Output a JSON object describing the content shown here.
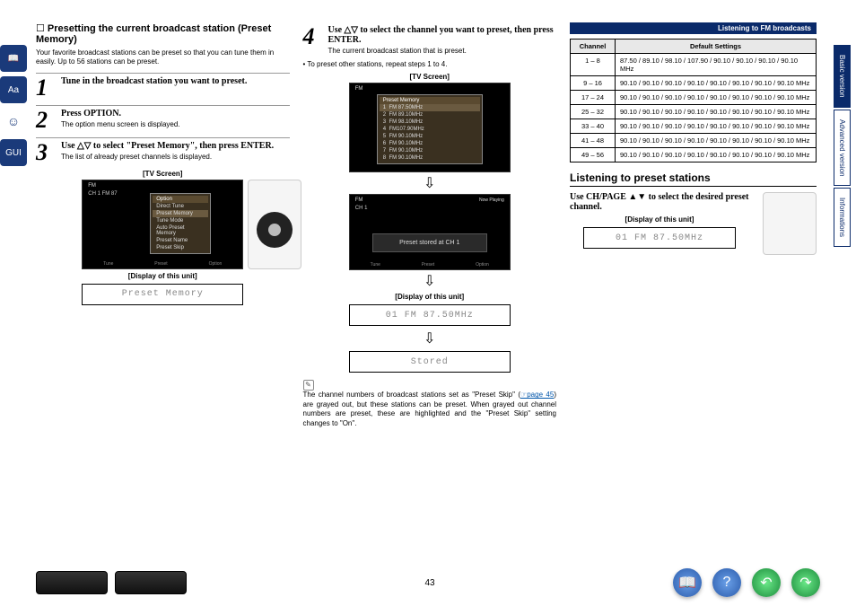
{
  "header": {
    "breadcrumb": "Listening to FM broadcasts"
  },
  "tabs": {
    "basic": "Basic version",
    "advanced": "Advanced version",
    "info": "Informations"
  },
  "left_icons": {
    "book": "book-icon",
    "aa": "Aa",
    "gui": "GUI"
  },
  "section1": {
    "title": "Presetting the current broadcast station (Preset Memory)",
    "desc": "Your favorite broadcast stations can be preset so that you can tune them in easily. Up to 56 stations can be preset."
  },
  "steps": {
    "s1": {
      "num": "1",
      "title": "Tune in the broadcast station you want to preset."
    },
    "s2": {
      "num": "2",
      "title": "Press OPTION.",
      "sub": "The option menu screen is displayed."
    },
    "s3": {
      "num": "3",
      "title": "Use △▽ to select \"Preset Memory\", then press ENTER.",
      "sub": "The list of already preset channels is displayed."
    },
    "s4": {
      "num": "4",
      "title": "Use △▽ to select the channel you want to preset, then press ENTER.",
      "sub": "The current broadcast station that is preset."
    }
  },
  "labels": {
    "tv_screen": "[TV Screen]",
    "display_unit": "[Display of this unit]",
    "tv_fm": "FM",
    "option": "Option",
    "preset_memory_title": "Preset Memory",
    "now_playing": "Now Playing",
    "ch1_station": "CH 1    FM 87"
  },
  "menu": {
    "items": [
      "Direct Tune",
      "Preset Memory",
      "Tune Mode",
      "Auto Preset Memory",
      "Preset Name",
      "Preset Skip"
    ]
  },
  "preset_list": [
    {
      "n": "1",
      "v": "FM 87.50MHz"
    },
    {
      "n": "2",
      "v": "FM 89.10MHz"
    },
    {
      "n": "3",
      "v": "FM 98.10MHz"
    },
    {
      "n": "4",
      "v": "FM107.90MHz"
    },
    {
      "n": "5",
      "v": "FM 90.10MHz"
    },
    {
      "n": "6",
      "v": "FM 90.10MHz"
    },
    {
      "n": "7",
      "v": "FM 90.10MHz"
    },
    {
      "n": "8",
      "v": "FM 90.10MHz"
    }
  ],
  "tv_bottom": {
    "tune": "Tune",
    "preset": "Preset",
    "option2": "Option"
  },
  "display1": "Preset Memory",
  "tv_msg": "Preset stored at CH 1",
  "display2": "01 FM  87.50MHz",
  "display3": "Stored",
  "repeat_note": "• To preset other stations, repeat steps 1 to 4.",
  "pencil_note": {
    "l1": "The channel numbers of broadcast stations set as \"Preset Skip\" (",
    "link": "☞page 45",
    "l2": ") are grayed out, but these stations can be preset. When grayed out channel numbers are preset, these are highlighted and the \"Preset Skip\" setting changes to \"On\"."
  },
  "table": {
    "h1": "Channel",
    "h2": "Default Settings",
    "rows": [
      {
        "ch": "1 – 8",
        "val": "87.50 / 89.10 / 98.10 / 107.90 / 90.10 / 90.10 / 90.10 / 90.10 MHz"
      },
      {
        "ch": "9 – 16",
        "val": "90.10 / 90.10 / 90.10 / 90.10 / 90.10 / 90.10 / 90.10 / 90.10 MHz"
      },
      {
        "ch": "17 – 24",
        "val": "90.10 / 90.10 / 90.10 / 90.10 / 90.10 / 90.10 / 90.10 / 90.10 MHz"
      },
      {
        "ch": "25 – 32",
        "val": "90.10 / 90.10 / 90.10 / 90.10 / 90.10 / 90.10 / 90.10 / 90.10 MHz"
      },
      {
        "ch": "33 – 40",
        "val": "90.10 / 90.10 / 90.10 / 90.10 / 90.10 / 90.10 / 90.10 / 90.10 MHz"
      },
      {
        "ch": "41 – 48",
        "val": "90.10 / 90.10 / 90.10 / 90.10 / 90.10 / 90.10 / 90.10 / 90.10 MHz"
      },
      {
        "ch": "49 – 56",
        "val": "90.10 / 90.10 / 90.10 / 90.10 / 90.10 / 90.10 / 90.10 / 90.10 MHz"
      }
    ]
  },
  "section2": {
    "title": "Listening to preset stations",
    "instr": "Use CH/PAGE ▲▼ to select the desired preset channel.",
    "display": "01 FM  87.50MHz"
  },
  "page_number": "43"
}
